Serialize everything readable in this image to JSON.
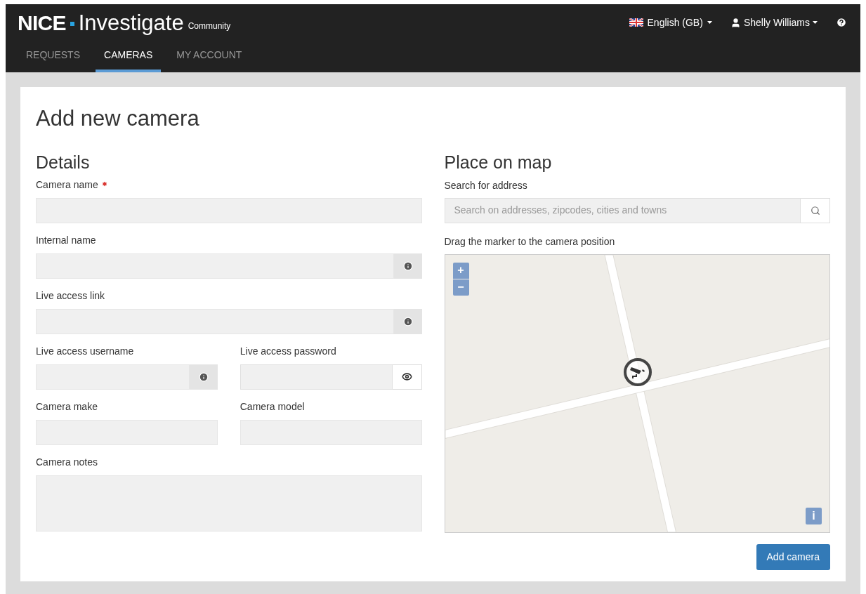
{
  "header": {
    "logo": {
      "brand": "NICE",
      "product": "Investigate",
      "edition": "Community"
    },
    "tabs": [
      {
        "label": "REQUESTS",
        "selected": false
      },
      {
        "label": "CAMERAS",
        "selected": true
      },
      {
        "label": "MY ACCOUNT",
        "selected": false
      }
    ],
    "language": "English (GB)",
    "user": "Shelly Williams"
  },
  "page": {
    "title": "Add new camera",
    "details": {
      "heading": "Details",
      "rows": [
        [
          {
            "label": "Camera name",
            "required": true,
            "kind": "plain"
          }
        ],
        [
          {
            "label": "Internal name",
            "required": false,
            "kind": "info"
          }
        ],
        [
          {
            "label": "Live access link",
            "required": false,
            "kind": "info"
          }
        ],
        [
          {
            "label": "Live access username",
            "required": false,
            "kind": "info"
          },
          {
            "label": "Live access password",
            "required": false,
            "kind": "reveal"
          }
        ],
        [
          {
            "label": "Camera make",
            "required": false,
            "kind": "plain"
          },
          {
            "label": "Camera model",
            "required": false,
            "kind": "plain"
          }
        ],
        [
          {
            "label": "Camera notes",
            "required": false,
            "kind": "textarea"
          }
        ]
      ]
    },
    "map": {
      "heading": "Place on map",
      "search_label": "Search for address",
      "search_placeholder": "Search on addresses, zipcodes, cities and towns",
      "hint": "Drag the marker to the camera position",
      "zoom_in": "+",
      "zoom_out": "−",
      "info": "i"
    },
    "submit": "Add camera"
  }
}
